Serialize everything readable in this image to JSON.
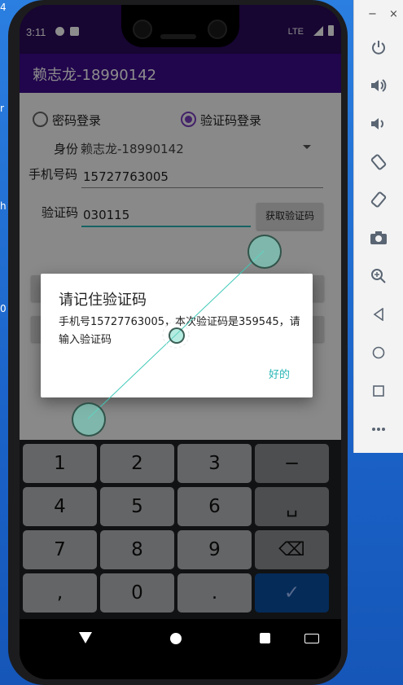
{
  "desktop": {
    "fragments": [
      "4",
      "r",
      "h",
      "0"
    ]
  },
  "status_bar": {
    "time": "3:11",
    "network": "LTE"
  },
  "app_bar": {
    "title": "赖志龙-18990142"
  },
  "login_mode": {
    "password_label": "密码登录",
    "sms_label": "验证码登录",
    "selected": "验证码登录"
  },
  "form": {
    "identity_label": "身份",
    "identity_value": "赖志龙-18990142",
    "phone_label": "手机号码",
    "phone_value": "15727763005",
    "code_label": "验证码",
    "code_value": "030115",
    "get_code_button": "获取验证码"
  },
  "dialog": {
    "title": "请记住验证码",
    "message": "手机号15727763005，本次验证码是359545，请输入验证码",
    "ok": "好的"
  },
  "keyboard": {
    "rows": [
      [
        "1",
        "2",
        "3",
        "−"
      ],
      [
        "4",
        "5",
        "6",
        "␣"
      ],
      [
        "7",
        "8",
        "9",
        "⌫"
      ],
      [
        ",",
        "0",
        ".",
        "✓"
      ]
    ]
  },
  "emulator_sidebar": {
    "window_controls": [
      "−",
      "×"
    ],
    "tools": [
      "power-icon",
      "volume-up-icon",
      "volume-down-icon",
      "rotate-left-icon",
      "rotate-right-icon",
      "screenshot-icon",
      "zoom-icon",
      "back-icon",
      "home-icon",
      "overview-icon",
      "more-icon"
    ]
  }
}
